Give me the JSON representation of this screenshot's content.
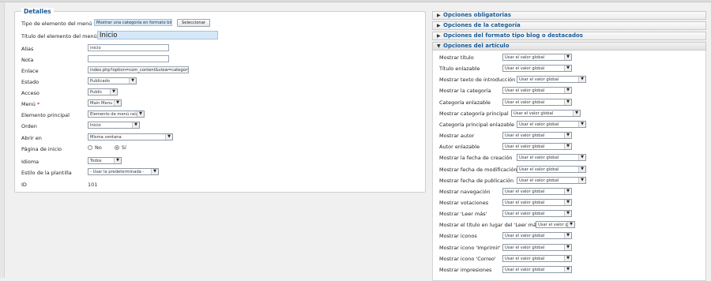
{
  "details": {
    "legend": "Detalles",
    "fields": {
      "menu_item_type": {
        "label": "Tipo de elemento del menú",
        "required": "*",
        "value": "Mostrar una categoría en formato blog",
        "button": "Seleccionar"
      },
      "title": {
        "label": "Título del elemento del menú",
        "required": "*",
        "value": "Inicio"
      },
      "alias": {
        "label": "Alias",
        "value": "inicio"
      },
      "note": {
        "label": "Nota",
        "value": ""
      },
      "link": {
        "label": "Enlace",
        "value": "index.php?option=com_content&view=category&layout="
      },
      "status": {
        "label": "Estado",
        "value": "Publicado"
      },
      "access": {
        "label": "Acceso",
        "value": "Public"
      },
      "menu": {
        "label": "Menú",
        "required": "*",
        "value": "Main Menu"
      },
      "parent": {
        "label": "Elemento principal",
        "value": "Elemento de menú raíz"
      },
      "order": {
        "label": "Orden",
        "value": "Inicio"
      },
      "open_in": {
        "label": "Abrir en",
        "value": "Misma ventana"
      },
      "home": {
        "label": "Página de inicio",
        "option_no": "No",
        "option_yes": "Sí",
        "selected": "Sí"
      },
      "language": {
        "label": "Idioma",
        "value": "Todos"
      },
      "template_style": {
        "label": "Estilo de la plantilla",
        "value": "- Usar la predeterminada -"
      },
      "id": {
        "label": "ID",
        "value": "101"
      }
    }
  },
  "panels": [
    {
      "label": "Opciones obligatorias",
      "open": false
    },
    {
      "label": "Opciones de la categoría",
      "open": false
    },
    {
      "label": "Opciones del formato tipo blog o destacados",
      "open": false
    },
    {
      "label": "Opciones del artículo",
      "open": true
    }
  ],
  "article_options": [
    {
      "label": "Mostrar título",
      "value": "Usar el valor global"
    },
    {
      "label": "Título enlazable",
      "value": "Usar el valor global"
    },
    {
      "label": "Mostrar texto de introducción",
      "value": "Usar el valor global"
    },
    {
      "label": "Mostrar la categoría",
      "value": "Usar el valor global"
    },
    {
      "label": "Categoría enlazable",
      "value": "Usar el valor global"
    },
    {
      "label": "Mostrar categoría principal",
      "value": "Usar el valor global"
    },
    {
      "label": "Categoría principal enlazable",
      "value": "Usar el valor global"
    },
    {
      "label": "Mostrar autor",
      "value": "Usar el valor global"
    },
    {
      "label": "Autor enlazable",
      "value": "Usar el valor global"
    },
    {
      "label": "Mostrar la fecha de creación",
      "value": "Usar el valor global"
    },
    {
      "label": "Mostrar fecha de modificación",
      "value": "Usar el valor global"
    },
    {
      "label": "Mostrar fecha de publicación",
      "value": "Usar el valor global"
    },
    {
      "label": "Mostrar navegación",
      "value": "Usar el valor global"
    },
    {
      "label": "Mostrar votaciones",
      "value": "Usar el valor global"
    },
    {
      "label": "Mostrar 'Leer más'",
      "value": "Usar el valor global"
    },
    {
      "label": "Mostrar el título en lugar del 'Leer más'",
      "value": "Usar el valor global"
    },
    {
      "label": "Mostrar iconos",
      "value": "Usar el valor global"
    },
    {
      "label": "Mostrar icono 'Imprimir'",
      "value": "Usar el valor global"
    },
    {
      "label": "Mostrar icono 'Correo'",
      "value": "Usar el valor global"
    },
    {
      "label": "Mostrar impresiones",
      "value": "Usar el valor global"
    }
  ]
}
